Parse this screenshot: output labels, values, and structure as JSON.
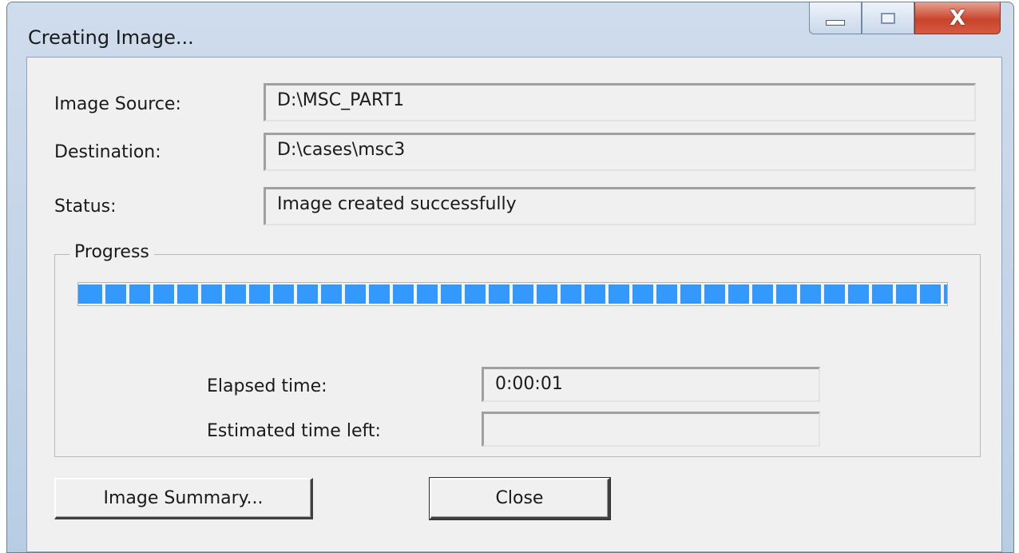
{
  "window": {
    "title": "Creating Image...",
    "controls": [
      "minimize-icon",
      "maximize-icon",
      "close-icon"
    ],
    "close_glyph": "X"
  },
  "fields": {
    "image_source": {
      "label": "Image Source:",
      "value": "D:\\MSC_PART1"
    },
    "destination": {
      "label": "Destination:",
      "value": "D:\\cases\\msc3"
    },
    "status": {
      "label": "Status:",
      "value": "Image created successfully"
    }
  },
  "progress": {
    "title": "Progress",
    "percent": 100,
    "elapsed_label": "Elapsed time:",
    "elapsed_value": "0:00:01",
    "remaining_label": "Estimated time left:",
    "remaining_value": ""
  },
  "buttons": {
    "summary_label": "Image Summary...",
    "close_label": "Close"
  },
  "colors": {
    "progress_fill": "#3399ff",
    "close_button": "#c8442c",
    "dialog_bg": "#f0f0f0"
  }
}
